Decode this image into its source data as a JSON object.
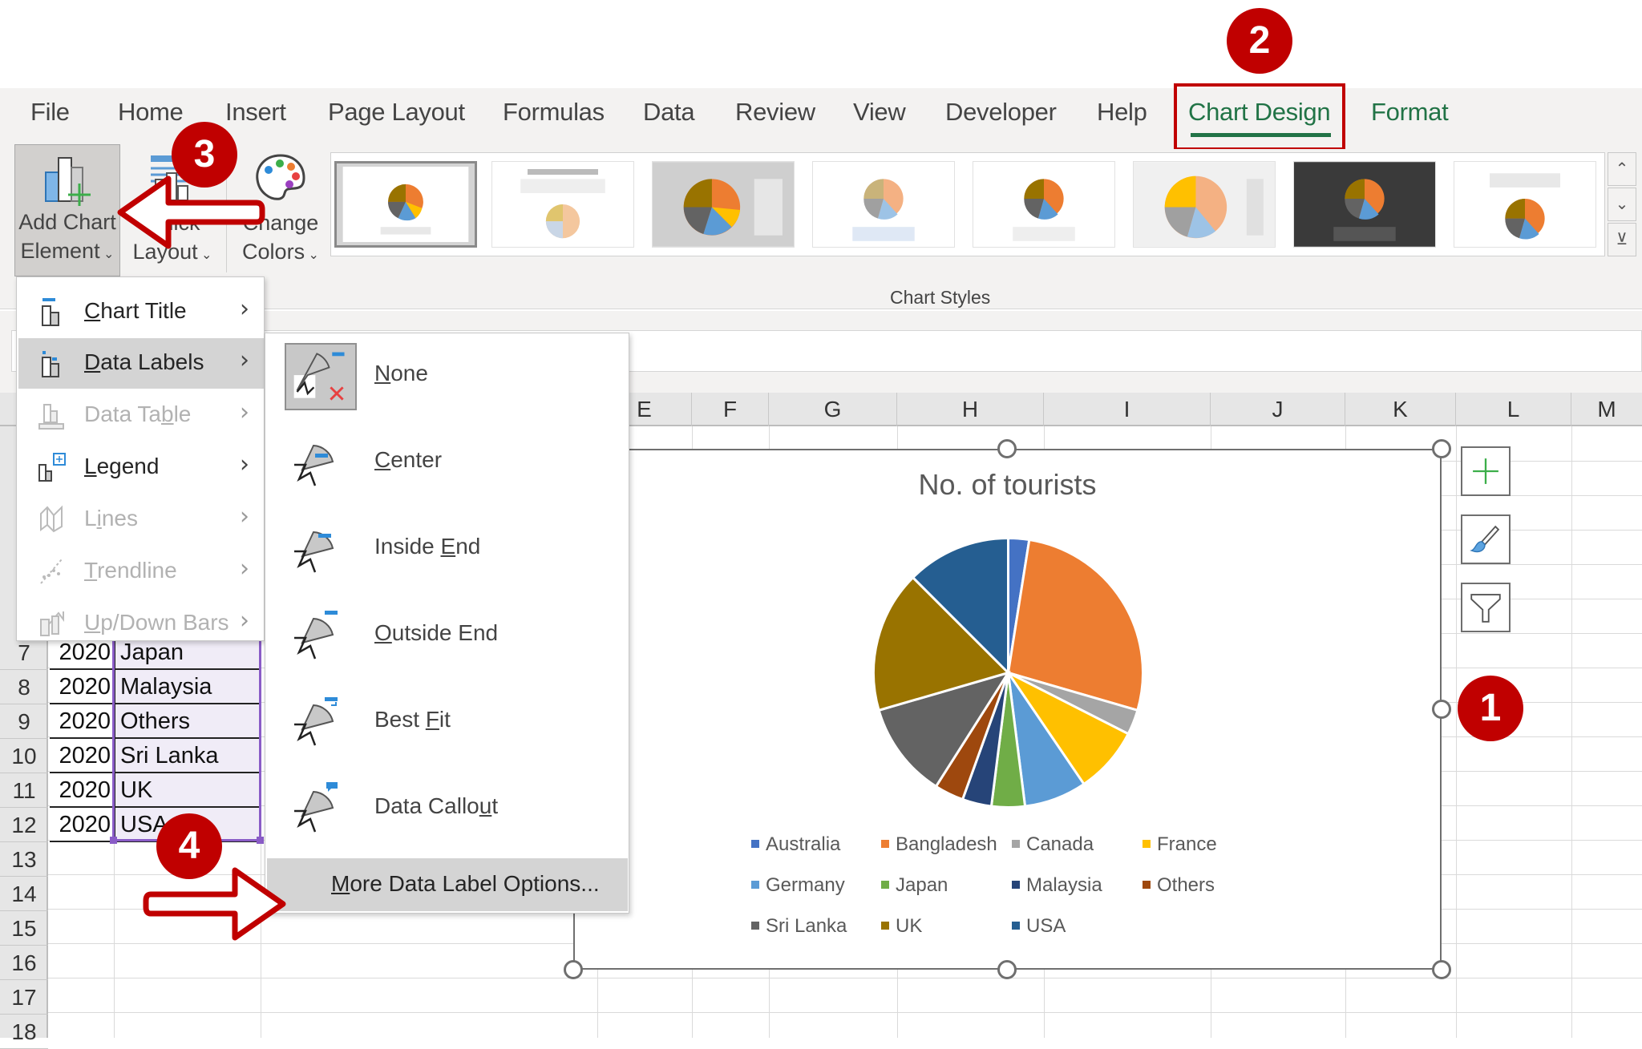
{
  "ribbon_tabs": [
    {
      "label": "File",
      "active": false
    },
    {
      "label": "Home",
      "active": false
    },
    {
      "label": "Insert",
      "active": false
    },
    {
      "label": "Page Layout",
      "active": false
    },
    {
      "label": "Formulas",
      "active": false
    },
    {
      "label": "Data",
      "active": false
    },
    {
      "label": "Review",
      "active": false
    },
    {
      "label": "View",
      "active": false
    },
    {
      "label": "Developer",
      "active": false
    },
    {
      "label": "Help",
      "active": false
    },
    {
      "label": "Chart Design",
      "active": true
    },
    {
      "label": "Format",
      "active": false
    }
  ],
  "ribbon": {
    "add_chart_element": {
      "line1": "Add Chart",
      "line2": "Element",
      "icon": "add-chart-element-icon"
    },
    "quick_layout": {
      "line1": "Quick",
      "line2": "Layout",
      "icon": "quick-layout-icon"
    },
    "change_colors": {
      "line1": "Change",
      "line2": "Colors",
      "icon": "palette-icon"
    },
    "chart_styles_label": "Chart Styles",
    "chart_styles_count": 8,
    "chart_styles_selected": 1,
    "gallery_scroll": {
      "up": "^",
      "down": "v",
      "more": "more"
    }
  },
  "add_chart_element_menu": [
    {
      "label": "Chart Title",
      "accel": "C",
      "enabled": true,
      "hovered": false,
      "icon": "chart-title-icon"
    },
    {
      "label": "Data Labels",
      "accel": "D",
      "enabled": true,
      "hovered": true,
      "icon": "data-labels-icon"
    },
    {
      "label": "Data Table",
      "accel": "b",
      "enabled": false,
      "hovered": false,
      "icon": "data-table-icon"
    },
    {
      "label": "Legend",
      "accel": "L",
      "enabled": true,
      "hovered": false,
      "icon": "legend-icon"
    },
    {
      "label": "Lines",
      "accel": "i",
      "enabled": false,
      "hovered": false,
      "icon": "lines-icon"
    },
    {
      "label": "Trendline",
      "accel": "T",
      "enabled": false,
      "hovered": false,
      "icon": "trendline-icon"
    },
    {
      "label": "Up/Down Bars",
      "accel": "U",
      "enabled": false,
      "hovered": false,
      "icon": "up-down-bars-icon"
    }
  ],
  "data_labels_submenu": [
    {
      "label": "None",
      "selected": true
    },
    {
      "label": "Center",
      "selected": false
    },
    {
      "label": "Inside End",
      "selected": false
    },
    {
      "label": "Outside End",
      "selected": false
    },
    {
      "label": "Best Fit",
      "selected": false
    },
    {
      "label": "Data Callout",
      "selected": false
    }
  ],
  "more_data_label_options": "More Data Label Options...",
  "spreadsheet": {
    "columns": [
      "E",
      "F",
      "G",
      "H",
      "I",
      "J",
      "K",
      "L",
      "M"
    ],
    "row_numbers": [
      "7",
      "8",
      "9",
      "10",
      "11",
      "12",
      "13",
      "14",
      "15",
      "16",
      "17",
      "18"
    ],
    "rows": [
      {
        "row": "7",
        "year": "2020",
        "country": "Japan"
      },
      {
        "row": "8",
        "year": "2020",
        "country": "Malaysia"
      },
      {
        "row": "9",
        "year": "2020",
        "country": "Others"
      },
      {
        "row": "10",
        "year": "2020",
        "country": "Sri Lanka"
      },
      {
        "row": "11",
        "year": "2020",
        "country": "UK"
      },
      {
        "row": "12",
        "year": "2020",
        "country": "USA"
      }
    ]
  },
  "chart_side_buttons": [
    {
      "name": "chart-elements-button",
      "icon": "plus-icon"
    },
    {
      "name": "chart-styles-button",
      "icon": "paintbrush-icon"
    },
    {
      "name": "chart-filters-button",
      "icon": "funnel-icon"
    }
  ],
  "annotations": [
    "1",
    "2",
    "3",
    "4"
  ],
  "chart_data": {
    "type": "pie",
    "title": "No. of tourists",
    "legend_position": "bottom",
    "categories": [
      "Australia",
      "Bangladesh",
      "Canada",
      "France",
      "Germany",
      "Japan",
      "Malaysia",
      "Others",
      "Sri Lanka",
      "UK",
      "USA"
    ],
    "values": [
      2.5,
      27,
      3,
      8,
      7.5,
      4,
      3.5,
      3.5,
      11.5,
      17,
      12.5
    ],
    "value_units": "approximate percent share (estimated from slice angles)",
    "colors": [
      "#4472c4",
      "#ed7d31",
      "#a5a5a5",
      "#ffc000",
      "#5b9bd5",
      "#70ad47",
      "#264478",
      "#9e480e",
      "#636363",
      "#997300",
      "#255e91"
    ],
    "start_angle_deg": 0,
    "direction": "clockwise",
    "data_labels": "none"
  }
}
